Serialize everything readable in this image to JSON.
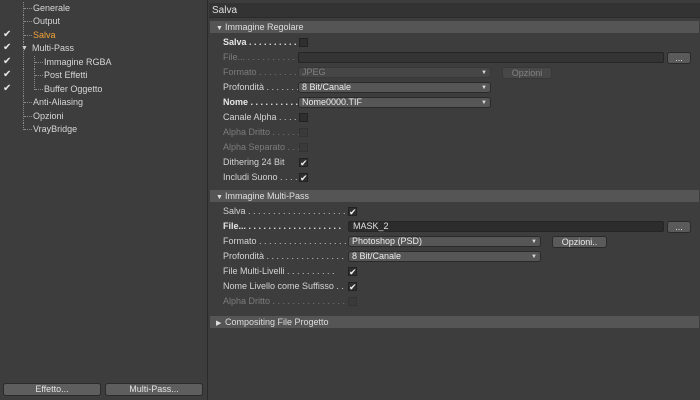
{
  "tree": [
    {
      "label": "Generale",
      "checked": false,
      "level": 0
    },
    {
      "label": "Output",
      "checked": false,
      "level": 0
    },
    {
      "label": "Salva",
      "checked": true,
      "level": 0,
      "active": true
    },
    {
      "label": "Multi-Pass",
      "checked": true,
      "level": 0,
      "expanded": true
    },
    {
      "label": "Immagine RGBA",
      "checked": true,
      "level": 1
    },
    {
      "label": "Post Effetti",
      "checked": true,
      "level": 1
    },
    {
      "label": "Buffer Oggetto",
      "checked": true,
      "level": 1
    },
    {
      "label": "Anti-Aliasing",
      "checked": false,
      "level": 0
    },
    {
      "label": "Opzioni",
      "checked": false,
      "level": 0
    },
    {
      "label": "VrayBridge",
      "checked": false,
      "level": 0
    }
  ],
  "left_buttons": {
    "effect": "Effetto...",
    "multipass": "Multi-Pass..."
  },
  "panel_title": "Salva",
  "regular": {
    "header": "Immagine Regolare",
    "save_label": "Salva",
    "file_label": "File...",
    "format_label": "Formato",
    "format_value": "JPEG",
    "options_button": "Opzioni",
    "depth_label": "Profondità",
    "depth_value": "8 Bit/Canale",
    "name_label": "Nome",
    "name_value": "Nome0000.TIF",
    "alpha_label": "Canale Alpha",
    "straight_label": "Alpha Dritto",
    "separate_label": "Alpha Separato",
    "dither_label": "Dithering 24 Bit",
    "sound_label": "Includi Suono",
    "file_button": "..."
  },
  "multipass": {
    "header": "Immagine Multi-Pass",
    "save_label": "Salva",
    "file_label": "File...",
    "file_value": "MASK_2",
    "file_button": "...",
    "format_label": "Formato",
    "format_value": "Photoshop (PSD)",
    "options_button": "Opzioni..",
    "depth_label": "Profondità",
    "depth_value": "8 Bit/Canale",
    "layers_label": "File Multi-Livelli",
    "suffix_label": "Nome Livello come Suffisso",
    "straight_label": "Alpha Dritto"
  },
  "compositing_header": "Compositing File Progetto",
  "colors": {
    "active_item": "#f2a23a",
    "background": "#3c3c3c",
    "section_header": "#555555"
  }
}
